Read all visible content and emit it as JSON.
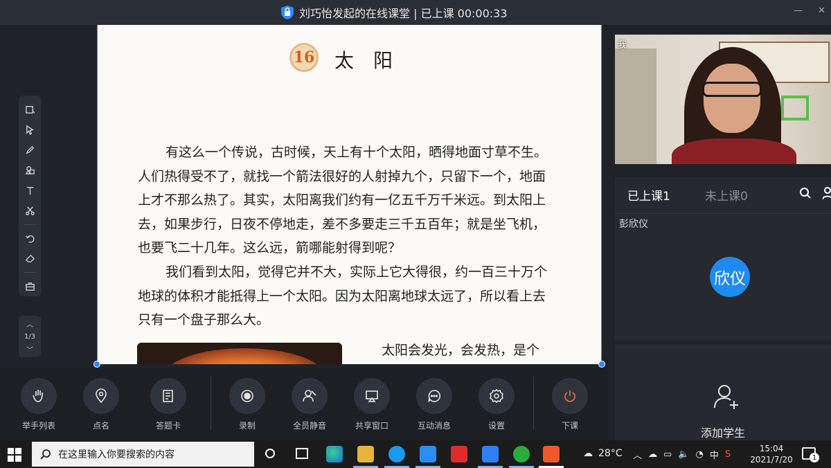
{
  "window": {
    "title": "刘巧怡发起的在线课堂 | 已上课 00:00:33",
    "minimize_icon": "minimize-icon",
    "close_icon": "close-icon"
  },
  "whiteboard": {
    "pager": "1/3",
    "tools": [
      "select-box-icon",
      "pointer-icon",
      "pen-icon",
      "shapes-icon",
      "text-icon",
      "scissors-icon",
      "undo-icon",
      "eraser-icon",
      "toolbox-icon"
    ]
  },
  "page": {
    "lesson_number": "16",
    "lesson_title": "太阳",
    "paragraph1": "有这么一个传说，古时候，天上有十个太阳，晒得地面寸草不生。人们热得受不了，就找一个箭法很好的人射掉九个，只留下一个，地面上才不那么热了。其实，太阳离我们约有一亿五千万千米远。到太阳上去，如果步行，日夜不停地走，差不多要走三千五百年；就是坐飞机，也要飞二十几年。这么远，箭哪能射得到呢？",
    "paragraph2": "我们看到太阳，觉得它并不大，实际上它大得很，约一百三十万个地球的体积才能抵得上一个太阳。因为太阳离地球太远了，所以看上去只有一个盘子那么大。",
    "paragraph3": "太阳会发光，会发热，是个"
  },
  "controls": [
    {
      "label": "举手列表",
      "icon": "raise-hand-icon"
    },
    {
      "label": "点名",
      "icon": "location-pin-icon"
    },
    {
      "label": "答题卡",
      "icon": "answer-card-icon"
    },
    {
      "label": "录制",
      "icon": "record-icon"
    },
    {
      "label": "全员静音",
      "icon": "mute-all-icon"
    },
    {
      "label": "共享窗口",
      "icon": "share-screen-icon"
    },
    {
      "label": "互动消息",
      "icon": "chat-icon"
    },
    {
      "label": "设置",
      "icon": "settings-icon"
    },
    {
      "label": "下课",
      "icon": "power-icon"
    }
  ],
  "right_panel": {
    "camera_label": "我",
    "tab_joined": "已上课1",
    "tab_not_joined": "未上课0",
    "student_name": "彭欣仪",
    "student_avatar_text": "欣仪",
    "add_student": "添加学生"
  },
  "taskbar": {
    "search_placeholder": "在这里输入你要搜索的内容",
    "temperature": "28°C",
    "ime": "中",
    "time": "15:04",
    "date": "2021/7/20",
    "notification_count": "1"
  },
  "colors": {
    "accent_blue": "#1e8bf0",
    "end_class_orange": "#ff6a3d",
    "app_bg": "#1f2329"
  }
}
